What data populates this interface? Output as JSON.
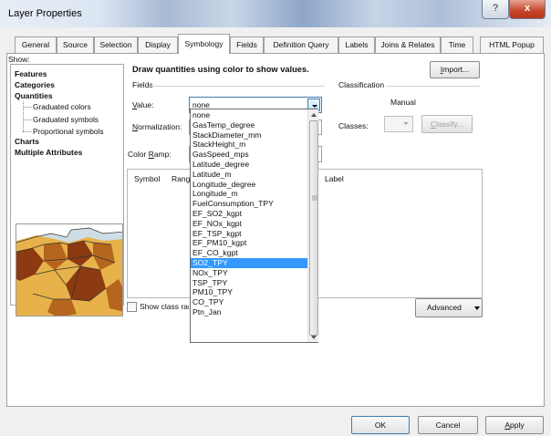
{
  "window": {
    "title": "Layer Properties",
    "help_glyph": "?",
    "close_glyph": "x"
  },
  "tabs": [
    "General",
    "Source",
    "Selection",
    "Display",
    "Symbology",
    "Fields",
    "Definition Query",
    "Labels",
    "Joins & Relates",
    "Time",
    "HTML Popup"
  ],
  "active_tab": "Symbology",
  "show": {
    "label": "Show:",
    "items": [
      {
        "label": "Features",
        "level": 0
      },
      {
        "label": "Categories",
        "level": 0
      },
      {
        "label": "Quantities",
        "level": 0
      },
      {
        "label": "Graduated colors",
        "level": 1
      },
      {
        "label": "Graduated symbols",
        "level": 1
      },
      {
        "label": "Proportional symbols",
        "level": 1
      },
      {
        "label": "Charts",
        "level": 0
      },
      {
        "label": "Multiple Attributes",
        "level": 0
      }
    ]
  },
  "main": {
    "heading": "Draw quantities using color to show values.",
    "import_button": "Import...",
    "fields_group": "Fields",
    "value_label": "Value:",
    "value_selected": "none",
    "normalization_label": "Normalization:",
    "color_ramp_label": "Color Ramp:",
    "columns": {
      "symbol": "Symbol",
      "range": "Range",
      "label": "Label"
    },
    "show_class_ranges": "Show class ranges using feature values",
    "advanced_button": "Advanced"
  },
  "classification": {
    "group": "Classification",
    "method": "Manual",
    "classes_label": "Classes:",
    "classify_button": "Classify..."
  },
  "dropdown": {
    "options": [
      "none",
      "GasTemp_degree",
      "StackDiameter_mm",
      "StackHeight_m",
      "GasSpeed_mps",
      "Latitude_degree",
      "Latitude_m",
      "Longitude_degree",
      "Longitude_m",
      "FuelConsumption_TPY",
      "EF_SO2_kgpt",
      "EF_NOx_kgpt",
      "EF_TSP_kgpt",
      "EF_PM10_kgpt",
      "EF_CO_kgpt",
      "SO2_TPY",
      "NOx_TPY",
      "TSP_TPY",
      "PM10_TPY",
      "CO_TPY",
      "Ptn_Jan"
    ],
    "highlighted": "SO2_TPY"
  },
  "footer": {
    "ok": "OK",
    "cancel": "Cancel",
    "apply": "Apply"
  },
  "colors": {
    "highlight": "#3399ff",
    "map_dark": "#8b3a12",
    "map_mid": "#b5651d",
    "map_light": "#e7b24a"
  }
}
